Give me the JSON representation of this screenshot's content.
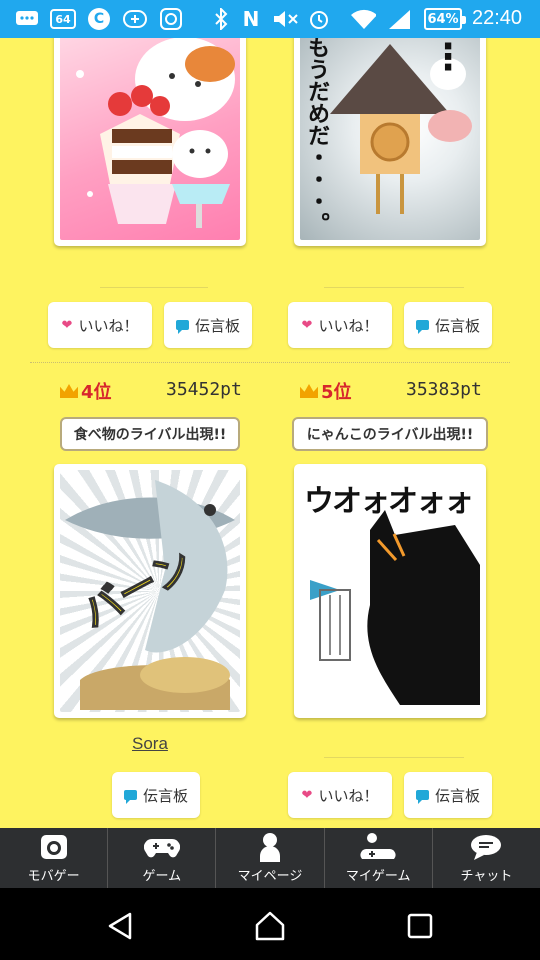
{
  "status_bar": {
    "icons": [
      "message-icon",
      "sixty-four-icon",
      "c-app-icon",
      "plus-app-icon",
      "browser-icon",
      "bluetooth-icon",
      "nfc-icon",
      "mute-icon",
      "alarm-icon",
      "wifi-icon",
      "signal-icon"
    ],
    "badge_64": "64",
    "c_letter": "C",
    "nfc_letter": "N",
    "battery": "64%",
    "time": "22:40"
  },
  "cards_top": {
    "left": {
      "image": "dessert-cat-illustration"
    },
    "right": {
      "image": "cookie-character-illustration",
      "art_text": "もうだめだ・・・。",
      "art_dots": "⋮"
    }
  },
  "actions": {
    "like_label": "いいね！",
    "board_label": "伝言板"
  },
  "entries": [
    {
      "rank": "4位",
      "points": "35452pt",
      "badge": "食べ物のライバル出現!!",
      "image": "fish-manga-illustration",
      "art_text": "バーン",
      "owner": "Sora"
    },
    {
      "rank": "5位",
      "points": "35383pt",
      "badge": "にゃんこのライバル出現!!",
      "image": "black-cat-fish-illustration",
      "art_text": "ウオォオォォ"
    }
  ],
  "tabs": [
    {
      "label": "モバゲー",
      "icon": "mobage-icon"
    },
    {
      "label": "ゲーム",
      "icon": "gamepad-icon"
    },
    {
      "label": "マイページ",
      "icon": "person-icon"
    },
    {
      "label": "マイゲーム",
      "icon": "my-game-icon"
    },
    {
      "label": "チャット",
      "icon": "chat-icon"
    }
  ],
  "colors": {
    "background": "#fef360",
    "status_bar": "#20a8ee",
    "rank_red": "#d7262c",
    "heart_pink": "#e84a86",
    "tab_bar": "#2d2f31"
  }
}
